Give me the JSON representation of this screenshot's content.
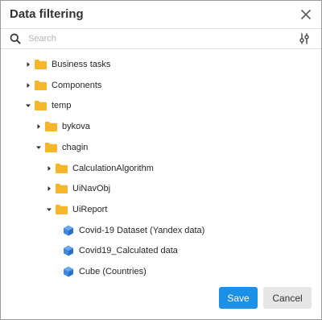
{
  "dialog": {
    "title": "Data filtering",
    "close_icon": "close-icon"
  },
  "search": {
    "placeholder": "Search",
    "value": "",
    "search_icon": "search-icon",
    "filter_icon": "filter-settings-icon"
  },
  "tree": {
    "nodes": [
      {
        "label": "Business tasks",
        "type": "folder",
        "expanded": false,
        "level": 0
      },
      {
        "label": "Components",
        "type": "folder",
        "expanded": false,
        "level": 0
      },
      {
        "label": "temp",
        "type": "folder",
        "expanded": true,
        "level": 0
      },
      {
        "label": "bykova",
        "type": "folder",
        "expanded": false,
        "level": 1
      },
      {
        "label": "chagin",
        "type": "folder",
        "expanded": true,
        "level": 1
      },
      {
        "label": "CalculationAlgorithm",
        "type": "folder",
        "expanded": false,
        "level": 2
      },
      {
        "label": "UiNavObj",
        "type": "folder",
        "expanded": false,
        "level": 2
      },
      {
        "label": "UiReport",
        "type": "folder",
        "expanded": true,
        "level": 2
      },
      {
        "label": "Covid-19 Dataset (Yandex data)",
        "type": "cube",
        "level": 3
      },
      {
        "label": "Covid19_Calculated data",
        "type": "cube",
        "level": 3
      },
      {
        "label": "Cube (Countries)",
        "type": "cube",
        "level": 3
      }
    ]
  },
  "footer": {
    "save_label": "Save",
    "cancel_label": "Cancel"
  },
  "colors": {
    "accent": "#1c8fe6",
    "folder": "#f7b52c",
    "cube": "#3f86e0"
  }
}
